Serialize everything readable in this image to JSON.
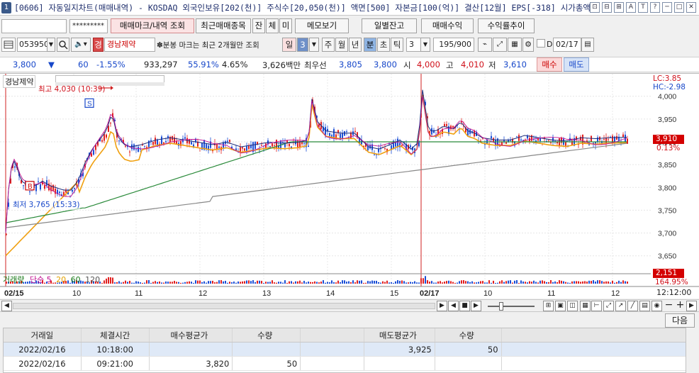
{
  "window": {
    "badge": "1",
    "title": "[0606] 자동일지차트(매매내역) - KOSDAQ 외국인보유[202(천)] 주식수[20,050(천)] 액면[500] 자본금[100(억)] 결산[12월] EPS[-318] 시가총액[7(",
    "buttons": [
      "⊡",
      "⊟",
      "⊞",
      "A",
      "T",
      "?",
      "─",
      "□",
      "✕"
    ]
  },
  "row1": {
    "account_masked": "*********",
    "btn_trade_mark": "매매마크/내역 조회",
    "btn_recent": "최근매매종목",
    "btn_jan": "잔",
    "btn_che": "체",
    "btn_mi": "미",
    "btn_memo": "메모보기",
    "btn_daily_balance": "일별잔고",
    "btn_trade_profit": "매매수익",
    "btn_return_trend": "수익률추이"
  },
  "row2": {
    "code": "053950",
    "stock_marker": "경",
    "stock_name": "경남제약",
    "notice": "✽분봉 마크는 최근 2개월만 조회",
    "period_label": "일",
    "period_value": "3",
    "units": [
      "주",
      "월",
      "년",
      "분",
      "초",
      "틱"
    ],
    "interval": "3",
    "count": "195",
    "count_max": "/900",
    "d_label": "D",
    "date": "02/17"
  },
  "quote": {
    "price": "3,800",
    "arrow": "▼",
    "change": "60",
    "change_pct": "-1.55%",
    "volume": "933,297",
    "pct1": "55.91%",
    "pct2": "4.65%",
    "amount": "3,626백만",
    "best_label": "최우선",
    "best_bid": "3,805",
    "best_ask": "3,800",
    "open_label": "시",
    "open": "4,000",
    "high_label": "고",
    "high": "4,010",
    "low_label": "저",
    "low": "3,610",
    "buy_label": "매수",
    "sell_label": "매도"
  },
  "chart": {
    "stock_label": "경남제약",
    "lc": "LC:3.85",
    "hc": "HC:-2.98",
    "high_mark": "최고 4,030 (10:39)",
    "low_mark": "최저 3,765 (15:33)",
    "current_price": "3,910",
    "current_pct": "0.13%",
    "volume_title": "거래량",
    "volume_ma_label": "단순",
    "volume_mas": [
      "5",
      "20",
      "60",
      "120"
    ],
    "volume_value": "2,151",
    "volume_pct": "164.95%",
    "y_ticks": [
      "4,000",
      "3,950",
      "3,900",
      "3,850",
      "3,800",
      "3,750",
      "3,700",
      "3,650"
    ],
    "x_labels": [
      "02/15",
      "10",
      "11",
      "12",
      "13",
      "14",
      "15",
      "02/17",
      "10",
      "11",
      "12"
    ],
    "time_display": "12:12:00",
    "colors": {
      "up": "#e02020",
      "down": "#1c4fd6",
      "ma_orange": "#f0a010",
      "ma_gray": "#888888",
      "ma_green": "#2a8a3a",
      "ma_navy": "#1a2a7a",
      "ma_magenta": "#c01090"
    }
  },
  "chart_data": {
    "type": "line",
    "title": "경남제약",
    "y_range": [
      3620,
      4040
    ],
    "series": [
      {
        "name": "단순 5",
        "values": []
      }
    ],
    "annotations": {
      "high": "최고 4,030 (10:39)",
      "low": "최저 3,765 (15:33)"
    }
  },
  "scroll": {
    "controls": [
      "▶",
      "◀",
      "■",
      "▶"
    ],
    "zoom_buttons": [
      "−",
      "+"
    ]
  },
  "trades": {
    "next_label": "다음",
    "headers": [
      "거래일",
      "체결시간",
      "매수평균가",
      "수량",
      "",
      "매도평균가",
      "수량",
      ""
    ],
    "rows": [
      {
        "date": "2022/02/16",
        "time": "10:18:00",
        "buy_avg": "",
        "buy_qty": "",
        "sell_avg": "3,925",
        "sell_qty": "50"
      },
      {
        "date": "2022/02/16",
        "time": "09:21:00",
        "buy_avg": "3,820",
        "buy_qty": "50",
        "sell_avg": "",
        "sell_qty": ""
      }
    ]
  }
}
